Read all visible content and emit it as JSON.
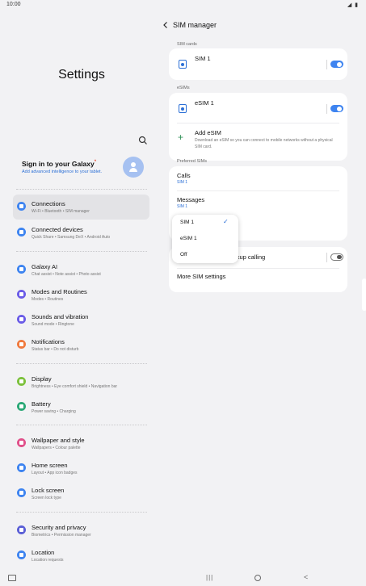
{
  "status_bar": {
    "time": "10:00",
    "icons": "◢ ▮"
  },
  "left_panel": {
    "title": "Settings",
    "profile": {
      "name": "Sign in to your Galaxy",
      "star": "*",
      "subtitle": "Add advanced intelligence to your tablet."
    },
    "menu": [
      {
        "title": "Connections",
        "subtitle": "Wi-Fi  •  Bluetooth  •  SIM manager",
        "color": "#3e84f0",
        "active": true
      },
      {
        "title": "Connected devices",
        "subtitle": "Quick Share  •  Samsung DeX  •  Android Auto",
        "color": "#3e84f0"
      },
      {
        "title": "Galaxy AI",
        "subtitle": "Chat assist  •  Note assist  •  Photo assist",
        "color": "#3e84f0"
      },
      {
        "title": "Modes and Routines",
        "subtitle": "Modes  •  Routines",
        "color": "#6b5ce7"
      },
      {
        "title": "Sounds and vibration",
        "subtitle": "Sound mode  •  Ringtone",
        "color": "#6b5ce7"
      },
      {
        "title": "Notifications",
        "subtitle": "Status bar  •  Do not disturb",
        "color": "#f07a3e"
      },
      {
        "title": "Display",
        "subtitle": "Brightness  •  Eye comfort shield  •  Navigation bar",
        "color": "#7cc13c"
      },
      {
        "title": "Battery",
        "subtitle": "Power saving  •  Charging",
        "color": "#2aa876"
      },
      {
        "title": "Wallpaper and style",
        "subtitle": "Wallpapers  •  Colour palette",
        "color": "#e0508a"
      },
      {
        "title": "Home screen",
        "subtitle": "Layout  •  App icon badges",
        "color": "#3e84f0"
      },
      {
        "title": "Lock screen",
        "subtitle": "Screen lock type",
        "color": "#3e84f0"
      },
      {
        "title": "Security and privacy",
        "subtitle": "Biometrics  •  Permission manager",
        "color": "#5b5fd6"
      },
      {
        "title": "Location",
        "subtitle": "Location requests",
        "color": "#3e84f0"
      }
    ]
  },
  "right_panel": {
    "title": "SIM manager",
    "sim_cards_label": "SIM cards",
    "sim1": {
      "label": "SIM 1",
      "enabled": true
    },
    "esims_label": "eSIMs",
    "esim1": {
      "label": "eSIM 1",
      "enabled": true
    },
    "add_esim": {
      "title": "Add eSIM",
      "subtitle": "Download an eSIM so you can connect to mobile networks without a physical SIM card."
    },
    "preferred_label": "Preferred SIMs",
    "calls": {
      "title": "Calls",
      "value": "SIM 1"
    },
    "messages": {
      "title": "Messages",
      "value": "SIM 1"
    },
    "backup_calling": {
      "label_visible": "ckup calling",
      "enabled": false
    },
    "more_settings": "More SIM settings",
    "dropdown": {
      "options": [
        "SIM 1",
        "eSIM 1",
        "Off"
      ],
      "selected": "SIM 1"
    }
  },
  "colors": {
    "accent": "#2b6fd6",
    "toggle_on": "#3e84f0"
  }
}
